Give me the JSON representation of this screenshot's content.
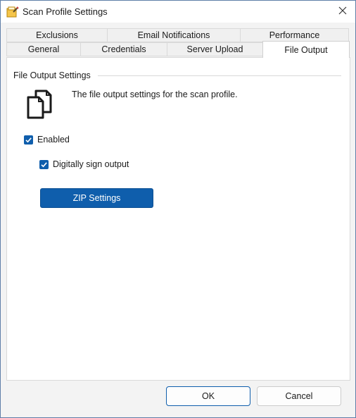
{
  "window": {
    "title": "Scan Profile Settings"
  },
  "tabs": {
    "row1": [
      {
        "label": "Exclusions"
      },
      {
        "label": "Email Notifications"
      },
      {
        "label": "Performance"
      }
    ],
    "row2": [
      {
        "label": "General"
      },
      {
        "label": "Credentials"
      },
      {
        "label": "Server Upload"
      },
      {
        "label": "File Output",
        "active": true
      }
    ]
  },
  "group": {
    "title": "File Output Settings"
  },
  "description": "The file output settings for the scan profile.",
  "options": {
    "enabled": {
      "label": "Enabled",
      "checked": true
    },
    "digitally_sign": {
      "label": "Digitally sign output",
      "checked": true
    }
  },
  "zip_button": {
    "label": "ZIP Settings"
  },
  "buttons": {
    "ok": "OK",
    "cancel": "Cancel"
  },
  "colors": {
    "accent": "#0f5eac",
    "window_bg": "#f3f3f3",
    "panel_bg": "#ffffff"
  },
  "icons": {
    "app": "scan-profile-app-icon",
    "close": "close-icon",
    "document": "documents-icon",
    "check": "checkmark-icon"
  }
}
